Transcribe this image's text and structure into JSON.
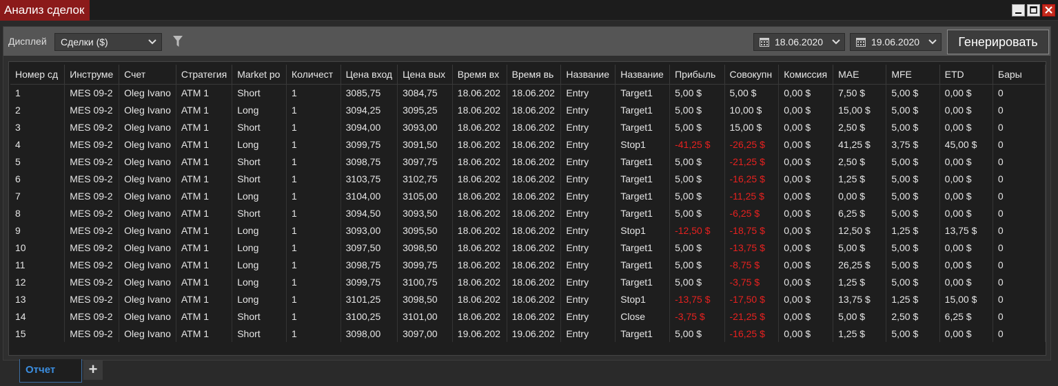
{
  "window": {
    "title": "Анализ сделок"
  },
  "toolbar": {
    "display_label": "Дисплей",
    "display_value": "Сделки ($)",
    "date_from": "18.06.2020",
    "date_to": "19.06.2020",
    "generate_label": "Генерировать"
  },
  "table": {
    "headers": [
      "Номер сд",
      "Инструме",
      "Счет",
      "Стратегия",
      "Market po",
      "Количест",
      "Цена вход",
      "Цена вых",
      "Время вх",
      "Время вь",
      "Название",
      "Название",
      "Прибыль",
      "Совокупн",
      "Комиссия",
      "MAE",
      "MFE",
      "ETD",
      "Бары"
    ],
    "rows": [
      [
        "1",
        "MES 09-2",
        "Oleg Ivano",
        "ATM 1",
        "Short",
        "1",
        "3085,75",
        "3084,75",
        "18.06.202",
        "18.06.202",
        "Entry",
        "Target1",
        "5,00 $",
        "5,00 $",
        "0,00 $",
        "7,50 $",
        "5,00 $",
        "0,00 $",
        "0"
      ],
      [
        "2",
        "MES 09-2",
        "Oleg Ivano",
        "ATM 1",
        "Long",
        "1",
        "3094,25",
        "3095,25",
        "18.06.202",
        "18.06.202",
        "Entry",
        "Target1",
        "5,00 $",
        "10,00 $",
        "0,00 $",
        "15,00 $",
        "5,00 $",
        "0,00 $",
        "0"
      ],
      [
        "3",
        "MES 09-2",
        "Oleg Ivano",
        "ATM 1",
        "Short",
        "1",
        "3094,00",
        "3093,00",
        "18.06.202",
        "18.06.202",
        "Entry",
        "Target1",
        "5,00 $",
        "15,00 $",
        "0,00 $",
        "2,50 $",
        "5,00 $",
        "0,00 $",
        "0"
      ],
      [
        "4",
        "MES 09-2",
        "Oleg Ivano",
        "ATM 1",
        "Long",
        "1",
        "3099,75",
        "3091,50",
        "18.06.202",
        "18.06.202",
        "Entry",
        "Stop1",
        "-41,25 $",
        "-26,25 $",
        "0,00 $",
        "41,25 $",
        "3,75 $",
        "45,00 $",
        "0"
      ],
      [
        "5",
        "MES 09-2",
        "Oleg Ivano",
        "ATM 1",
        "Short",
        "1",
        "3098,75",
        "3097,75",
        "18.06.202",
        "18.06.202",
        "Entry",
        "Target1",
        "5,00 $",
        "-21,25 $",
        "0,00 $",
        "2,50 $",
        "5,00 $",
        "0,00 $",
        "0"
      ],
      [
        "6",
        "MES 09-2",
        "Oleg Ivano",
        "ATM 1",
        "Short",
        "1",
        "3103,75",
        "3102,75",
        "18.06.202",
        "18.06.202",
        "Entry",
        "Target1",
        "5,00 $",
        "-16,25 $",
        "0,00 $",
        "1,25 $",
        "5,00 $",
        "0,00 $",
        "0"
      ],
      [
        "7",
        "MES 09-2",
        "Oleg Ivano",
        "ATM 1",
        "Long",
        "1",
        "3104,00",
        "3105,00",
        "18.06.202",
        "18.06.202",
        "Entry",
        "Target1",
        "5,00 $",
        "-11,25 $",
        "0,00 $",
        "0,00 $",
        "5,00 $",
        "0,00 $",
        "0"
      ],
      [
        "8",
        "MES 09-2",
        "Oleg Ivano",
        "ATM 1",
        "Short",
        "1",
        "3094,50",
        "3093,50",
        "18.06.202",
        "18.06.202",
        "Entry",
        "Target1",
        "5,00 $",
        "-6,25 $",
        "0,00 $",
        "6,25 $",
        "5,00 $",
        "0,00 $",
        "0"
      ],
      [
        "9",
        "MES 09-2",
        "Oleg Ivano",
        "ATM 1",
        "Long",
        "1",
        "3093,00",
        "3095,50",
        "18.06.202",
        "18.06.202",
        "Entry",
        "Stop1",
        "-12,50 $",
        "-18,75 $",
        "0,00 $",
        "12,50 $",
        "1,25 $",
        "13,75 $",
        "0"
      ],
      [
        "10",
        "MES 09-2",
        "Oleg Ivano",
        "ATM 1",
        "Long",
        "1",
        "3097,50",
        "3098,50",
        "18.06.202",
        "18.06.202",
        "Entry",
        "Target1",
        "5,00 $",
        "-13,75 $",
        "0,00 $",
        "5,00 $",
        "5,00 $",
        "0,00 $",
        "0"
      ],
      [
        "11",
        "MES 09-2",
        "Oleg Ivano",
        "ATM 1",
        "Long",
        "1",
        "3098,75",
        "3099,75",
        "18.06.202",
        "18.06.202",
        "Entry",
        "Target1",
        "5,00 $",
        "-8,75 $",
        "0,00 $",
        "26,25 $",
        "5,00 $",
        "0,00 $",
        "0"
      ],
      [
        "12",
        "MES 09-2",
        "Oleg Ivano",
        "ATM 1",
        "Long",
        "1",
        "3099,75",
        "3100,75",
        "18.06.202",
        "18.06.202",
        "Entry",
        "Target1",
        "5,00 $",
        "-3,75 $",
        "0,00 $",
        "1,25 $",
        "5,00 $",
        "0,00 $",
        "0"
      ],
      [
        "13",
        "MES 09-2",
        "Oleg Ivano",
        "ATM 1",
        "Long",
        "1",
        "3101,25",
        "3098,50",
        "18.06.202",
        "18.06.202",
        "Entry",
        "Stop1",
        "-13,75 $",
        "-17,50 $",
        "0,00 $",
        "13,75 $",
        "1,25 $",
        "15,00 $",
        "0"
      ],
      [
        "14",
        "MES 09-2",
        "Oleg Ivano",
        "ATM 1",
        "Short",
        "1",
        "3100,25",
        "3101,00",
        "18.06.202",
        "18.06.202",
        "Entry",
        "Close",
        "-3,75 $",
        "-21,25 $",
        "0,00 $",
        "5,00 $",
        "2,50 $",
        "6,25 $",
        "0"
      ],
      [
        "15",
        "MES 09-2",
        "Oleg Ivano",
        "ATM 1",
        "Short",
        "1",
        "3098,00",
        "3097,00",
        "19.06.202",
        "19.06.202",
        "Entry",
        "Target1",
        "5,00 $",
        "-16,25 $",
        "0,00 $",
        "1,25 $",
        "5,00 $",
        "0,00 $",
        "0"
      ]
    ]
  },
  "tabs": {
    "report": "Отчет",
    "add": "+"
  },
  "colors": {
    "title_tab": "#8b1a1a",
    "negative": "#e8211f",
    "active_tab": "#3b8ee0"
  },
  "icons": [
    "minimize-icon",
    "maximize-icon",
    "close-icon",
    "filter-icon",
    "calendar-icon",
    "chevron-down-icon"
  ]
}
